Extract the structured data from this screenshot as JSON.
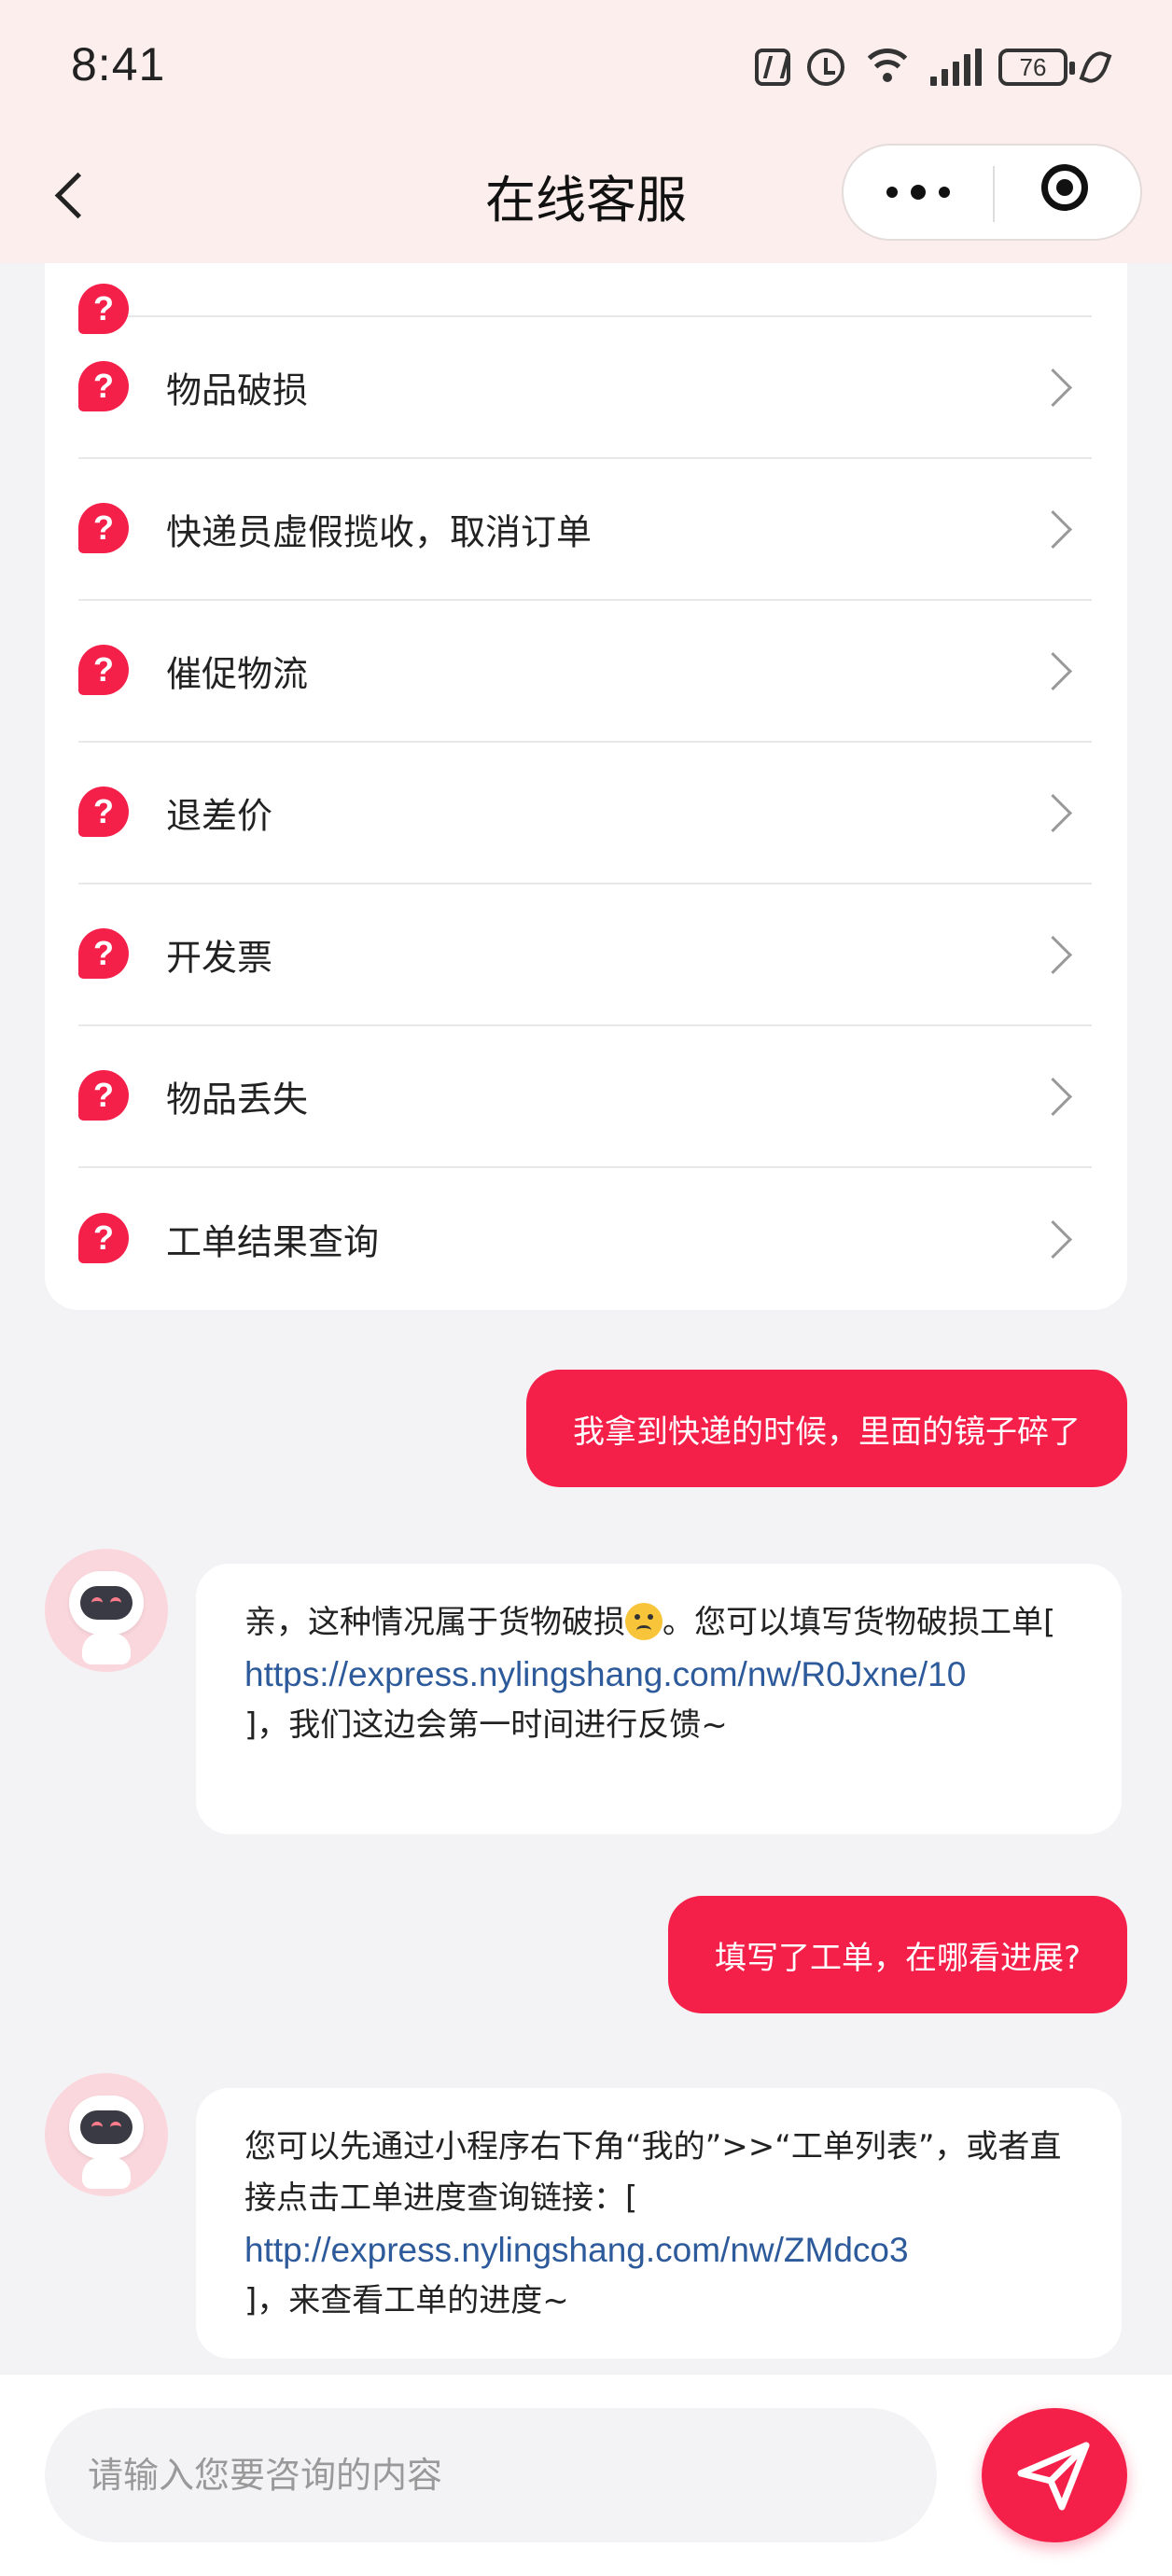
{
  "status_bar": {
    "time": "8:41",
    "battery": "76"
  },
  "header": {
    "title": "在线客服"
  },
  "faq": {
    "items": [
      {
        "label": "物品破损"
      },
      {
        "label": "快递员虚假揽收，取消订单"
      },
      {
        "label": "催促物流"
      },
      {
        "label": "退差价"
      },
      {
        "label": "开发票"
      },
      {
        "label": "物品丢失"
      },
      {
        "label": "工单结果查询"
      }
    ]
  },
  "messages": [
    {
      "role": "user",
      "text": "我拿到快递的时候，里面的镜子碎了"
    },
    {
      "role": "bot",
      "text_1": "亲，这种情况属于货物破损",
      "text_2": "。您可以填写货物破损工单[",
      "link": "https://express.nylingshang.com/nw/R0Jxne/10",
      "text_3": "]，我们这边会第一时间进行反馈~"
    },
    {
      "role": "user",
      "text": "填写了工单，在哪看进展?"
    },
    {
      "role": "bot",
      "text_1": "您可以先通过小程序右下角“我的”>>“工单列表”，或者直接点击工单进度查询链接：[",
      "link": "http://express.nylingshang.com/nw/ZMdco3",
      "text_2": "]，来查看工单的进度~"
    }
  ],
  "input": {
    "placeholder": "请输入您要咨询的内容",
    "value": ""
  },
  "colors": {
    "accent": "#f5204a",
    "link": "#2d5a9a",
    "header_bg": "#fbeeec"
  }
}
